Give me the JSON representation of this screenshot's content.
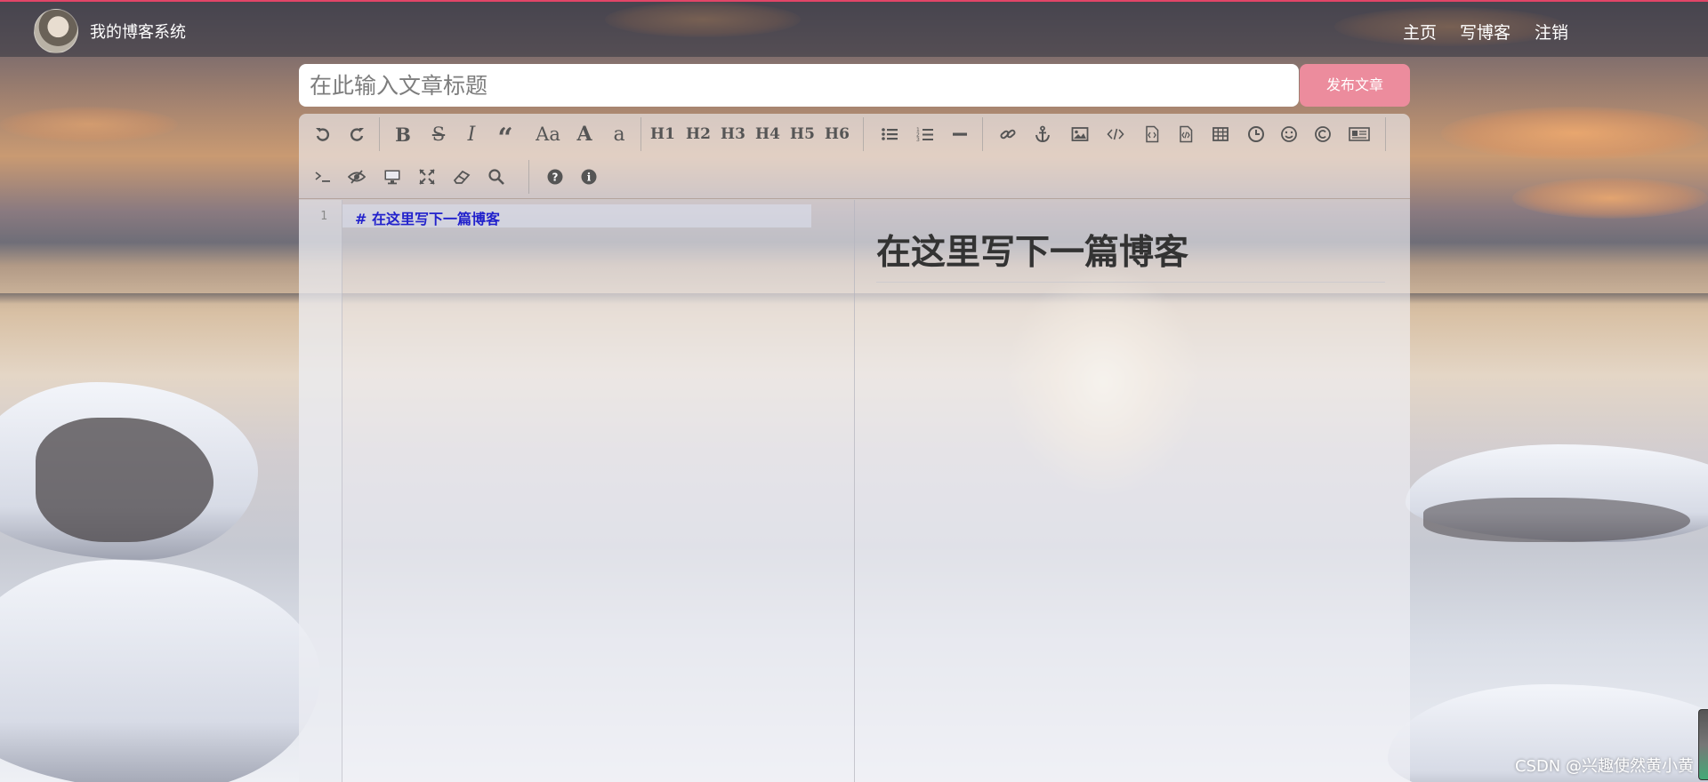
{
  "nav": {
    "brand": "我的博客系统",
    "links": [
      "主页",
      "写博客",
      "注销"
    ]
  },
  "editor_header": {
    "title_placeholder": "在此输入文章标题",
    "publish_label": "发布文章"
  },
  "toolbar": {
    "heading_labels": [
      "H1",
      "H2",
      "H3",
      "H4",
      "H5",
      "H6"
    ],
    "case_labels": [
      "Aa",
      "A",
      "a"
    ],
    "tools_row1": [
      "undo-icon",
      "redo-icon",
      "bold-icon",
      "strikethrough-icon",
      "italic-icon",
      "quote-icon",
      "uppercase-first-icon",
      "uppercase-icon",
      "lowercase-icon",
      "h1",
      "h2",
      "h3",
      "h4",
      "h5",
      "h6",
      "unordered-list-icon",
      "ordered-list-icon",
      "horizontal-rule-icon",
      "link-icon",
      "anchor-icon",
      "image-icon",
      "code-icon",
      "code-block-icon",
      "code-file-icon",
      "table-icon",
      "clock-icon",
      "emoji-icon",
      "copyright-icon",
      "html-entities-icon"
    ],
    "tools_row2": [
      "terminal-icon",
      "hide-preview-icon",
      "desktop-preview-icon",
      "fullscreen-icon",
      "eraser-icon",
      "search-icon",
      "help-icon",
      "info-icon"
    ]
  },
  "code": {
    "line_number": "1",
    "line_text": "# 在这里写下一篇博客"
  },
  "preview": {
    "heading": "在这里写下一篇博客"
  },
  "watermark": "CSDN @兴趣使然黄小黄",
  "colors": {
    "accent": "#e24567",
    "publish_button": "#ec8c9d",
    "code_heading": "#2222cc",
    "preview_heading": "#333333"
  }
}
